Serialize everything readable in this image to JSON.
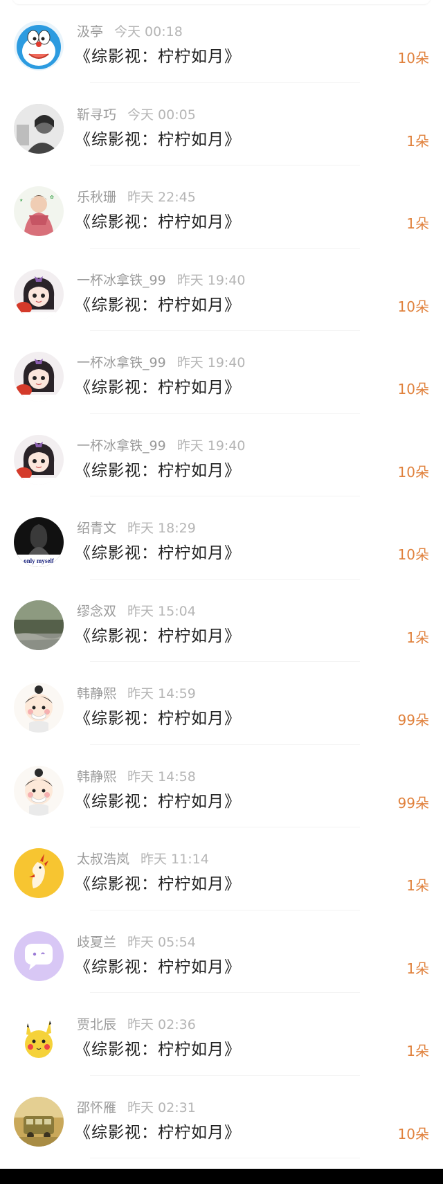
{
  "colors": {
    "name": "#9a9a9a",
    "time": "#b5b5b5",
    "title": "#222222",
    "amount": "#e0813c"
  },
  "records": [
    {
      "name": "汲亭",
      "time": "今天 00:18",
      "title": "《综影视：柠柠如月》",
      "amount": "10朵",
      "avatar": "doraemon-avatar"
    },
    {
      "name": "靳寻巧",
      "time": "今天 00:05",
      "title": "《综影视：柠柠如月》",
      "amount": "1朵",
      "avatar": "bw-portrait-avatar"
    },
    {
      "name": "乐秋珊",
      "time": "昨天 22:45",
      "title": "《综影视：柠柠如月》",
      "amount": "1朵",
      "avatar": "pink-scarf-avatar"
    },
    {
      "name": "一杯冰拿铁_99",
      "time": "昨天 19:40",
      "title": "《综影视：柠柠如月》",
      "amount": "10朵",
      "avatar": "anime-girl-avatar"
    },
    {
      "name": "一杯冰拿铁_99",
      "time": "昨天 19:40",
      "title": "《综影视：柠柠如月》",
      "amount": "10朵",
      "avatar": "anime-girl-avatar"
    },
    {
      "name": "一杯冰拿铁_99",
      "time": "昨天 19:40",
      "title": "《综影视：柠柠如月》",
      "amount": "10朵",
      "avatar": "anime-girl-avatar"
    },
    {
      "name": "绍青文",
      "time": "昨天 18:29",
      "title": "《综影视：柠柠如月》",
      "amount": "10朵",
      "avatar": "only-myself-avatar",
      "avatar_text": "only myself"
    },
    {
      "name": "缪念双",
      "time": "昨天 15:04",
      "title": "《综影视：柠柠如月》",
      "amount": "1朵",
      "avatar": "landscape-avatar"
    },
    {
      "name": "韩静熙",
      "time": "昨天 14:59",
      "title": "《综影视：柠柠如月》",
      "amount": "99朵",
      "avatar": "cartoon-girl-avatar"
    },
    {
      "name": "韩静熙",
      "time": "昨天 14:58",
      "title": "《综影视：柠柠如月》",
      "amount": "99朵",
      "avatar": "cartoon-girl-avatar"
    },
    {
      "name": "太叔浩岚",
      "time": "昨天 11:14",
      "title": "《综影视：柠柠如月》",
      "amount": "1朵",
      "avatar": "yellow-bird-avatar"
    },
    {
      "name": "歧夏兰",
      "time": "昨天 05:54",
      "title": "《综影视：柠柠如月》",
      "amount": "1朵",
      "avatar": "chat-bubble-avatar"
    },
    {
      "name": "贾北辰",
      "time": "昨天 02:36",
      "title": "《综影视：柠柠如月》",
      "amount": "1朵",
      "avatar": "pikachu-avatar"
    },
    {
      "name": "邵怀雁",
      "time": "昨天 02:31",
      "title": "《综影视：柠柠如月》",
      "amount": "10朵",
      "avatar": "bus-avatar"
    }
  ]
}
